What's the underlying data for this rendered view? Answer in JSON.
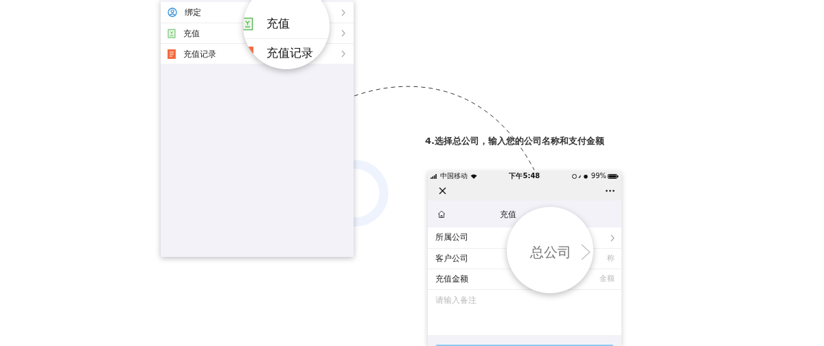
{
  "left_phone": {
    "menu": [
      {
        "label": "绑定",
        "kind": "user"
      },
      {
        "label": "充值",
        "kind": "receipt"
      },
      {
        "label": "充值记录",
        "kind": "list"
      }
    ],
    "magnifier": [
      {
        "label": "充值",
        "kind": "receipt"
      },
      {
        "label": "充值记录",
        "kind": "list"
      }
    ]
  },
  "caption": "4.选择总公司，输入您的公司名称和支付金额",
  "right_phone": {
    "status_bar": {
      "carrier": "中国移动",
      "time": "下午5:48",
      "battery": "99%"
    },
    "title": "充值",
    "form": [
      {
        "label": "所属公司",
        "kind": "select"
      },
      {
        "label": "客户公司",
        "kind": "input",
        "placeholder": "称"
      },
      {
        "label": "充值金额",
        "kind": "input",
        "placeholder": "金额"
      }
    ],
    "remark": {
      "placeholder": "请输入备注"
    },
    "magnifier": {
      "value": "总公司"
    }
  }
}
